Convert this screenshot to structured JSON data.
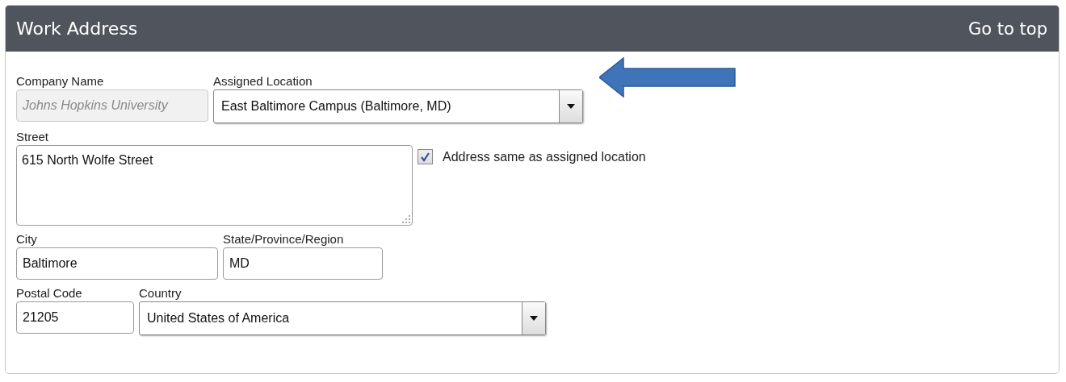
{
  "panel": {
    "title": "Work Address",
    "link": "Go to top"
  },
  "rows": [
    {
      "fields": [
        {
          "kind": "text",
          "label": "Company Name",
          "value": "Johns Hopkins University",
          "disabled": true
        },
        {
          "kind": "select",
          "label": "Assigned Location",
          "value": "East Baltimore Campus (Baltimore, MD)",
          "disabled": false
        }
      ],
      "arrow": true
    },
    {
      "fields": [
        {
          "kind": "textarea",
          "label": "Street",
          "value": "615 North Wolfe Street",
          "disabled": false
        }
      ],
      "checkbox": {
        "label": "Address same as assigned location",
        "checked": true
      }
    },
    {
      "fields": [
        {
          "kind": "text",
          "label": "City",
          "value": "Baltimore",
          "disabled": false
        },
        {
          "kind": "text",
          "label": "State/Province/Region",
          "value": "MD",
          "disabled": false
        }
      ]
    },
    {
      "fields": [
        {
          "kind": "text",
          "label": "Postal Code",
          "value": "21205",
          "disabled": false
        },
        {
          "kind": "select",
          "label": "Country",
          "value": "United States of America",
          "disabled": false
        }
      ]
    }
  ]
}
